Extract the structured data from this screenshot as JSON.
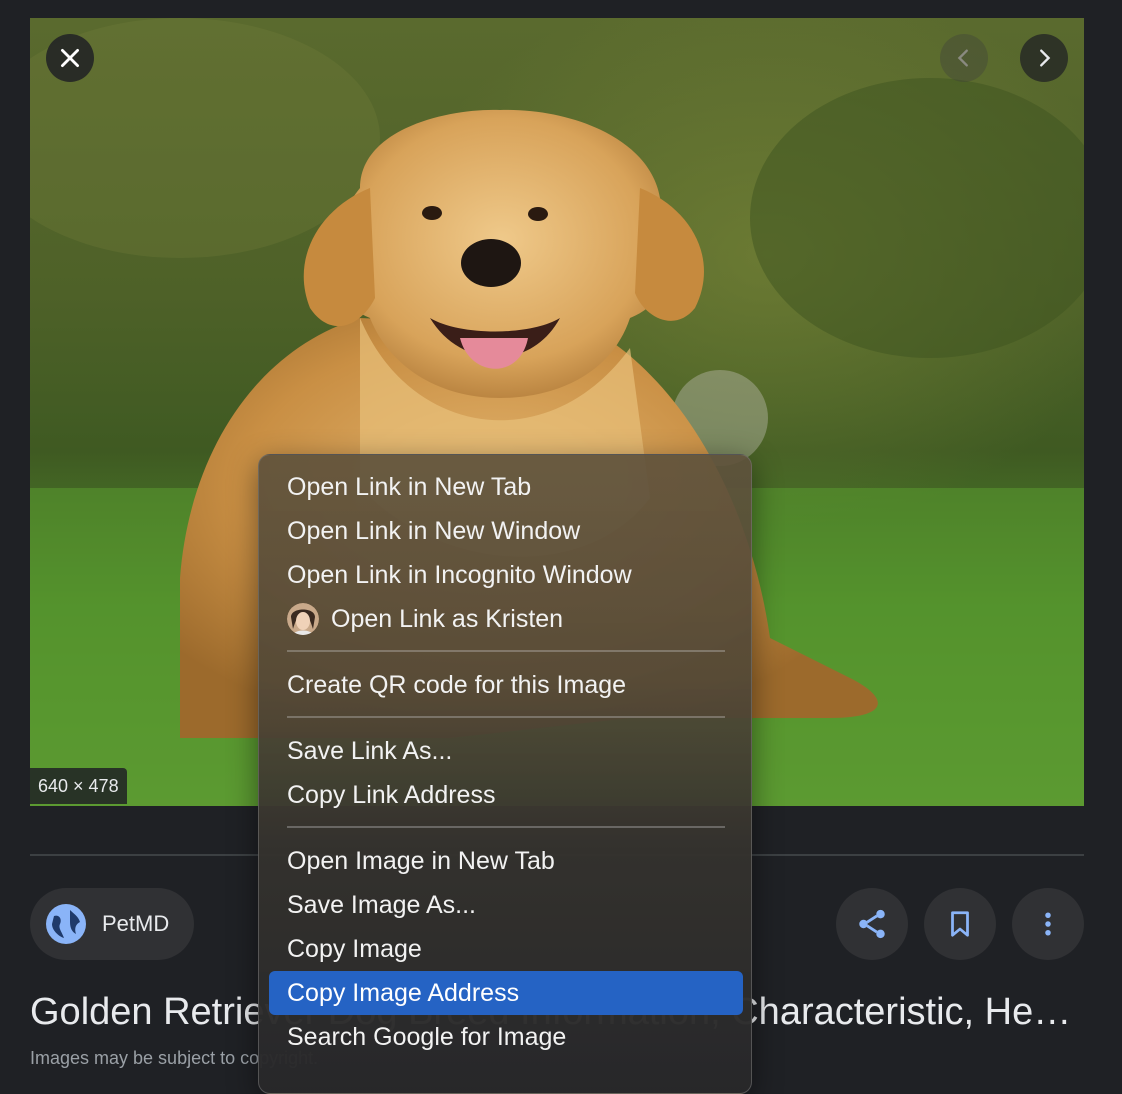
{
  "viewer": {
    "image_dimensions": "640 × 478"
  },
  "source": {
    "name": "PetMD"
  },
  "result": {
    "title": "Golden Retriever Dog Breed Information, Characteristic, Health and Lif…",
    "copyright_note": "Images may be subject to copyright."
  },
  "context_menu": {
    "items": [
      {
        "label": "Open Link in New Tab"
      },
      {
        "label": "Open Link in New Window"
      },
      {
        "label": "Open Link in Incognito Window"
      },
      {
        "label": "Open Link as Kristen",
        "icon": "profile-avatar"
      },
      {
        "label": "Create QR code for this Image"
      },
      {
        "label": "Save Link As..."
      },
      {
        "label": "Copy Link Address"
      },
      {
        "label": "Open Image in New Tab"
      },
      {
        "label": "Save Image As..."
      },
      {
        "label": "Copy Image"
      },
      {
        "label": "Copy Image Address",
        "highlighted": true
      },
      {
        "label": "Search Google for Image"
      }
    ]
  },
  "colors": {
    "background": "#1f2125",
    "chip": "#303134",
    "accent_icon": "#8ab4f8",
    "menu_highlight": "#2563c4"
  },
  "icons": [
    "close-icon",
    "chevron-left-icon",
    "chevron-right-icon",
    "globe-icon",
    "share-icon",
    "bookmark-icon",
    "more-vert-icon"
  ]
}
